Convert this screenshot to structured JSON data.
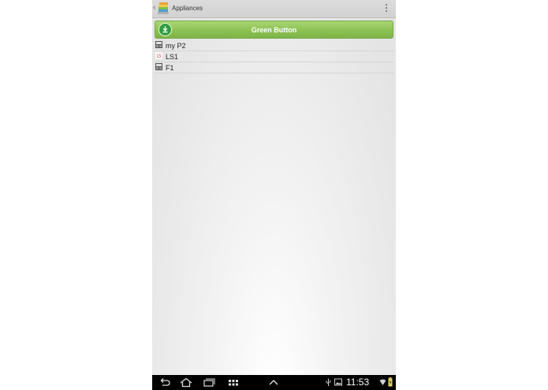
{
  "action_bar": {
    "title": "Appliances"
  },
  "green_button": {
    "label": "Green Button"
  },
  "appliances": [
    {
      "label": "my P2",
      "icon": "meter-icon"
    },
    {
      "label": "LS1",
      "icon": "ls-icon",
      "icon_text": "LS"
    },
    {
      "label": "F1",
      "icon": "meter-icon"
    }
  ],
  "status_bar": {
    "time": "11:53"
  },
  "colors": {
    "green_button": "#8cc251",
    "nav_bar": "#000000"
  }
}
